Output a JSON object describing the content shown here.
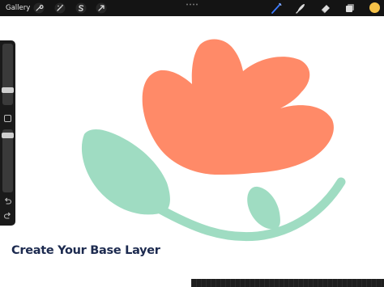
{
  "toolbar": {
    "gallery_label": "Gallery",
    "left_tools": [
      {
        "name": "wrench-icon"
      },
      {
        "name": "magic-wand-icon"
      },
      {
        "name": "selection-s-icon"
      },
      {
        "name": "transform-arrow-icon"
      }
    ],
    "right_tools": [
      {
        "name": "brush-icon",
        "active": true
      },
      {
        "name": "smudge-icon"
      },
      {
        "name": "eraser-icon"
      },
      {
        "name": "layers-icon"
      }
    ],
    "current_color": "#f6c248",
    "active_tool_color": "#3d7bff"
  },
  "sidebar": {
    "undo_icon": "undo-icon",
    "redo_icon": "redo-icon",
    "modify_icon": "square-modify-icon"
  },
  "artwork": {
    "flower_color": "#ff8a68",
    "leaf_color": "#9fdcc2"
  },
  "caption": "Create Your Base Layer"
}
